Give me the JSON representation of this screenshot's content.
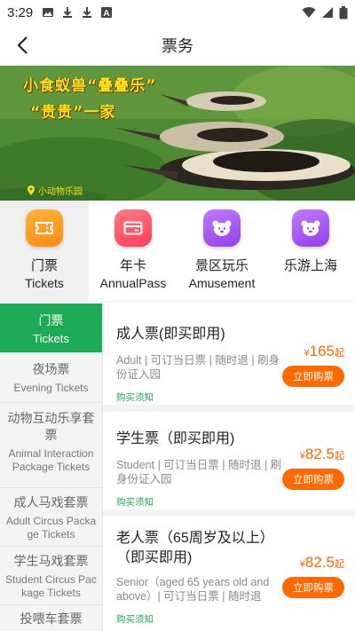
{
  "status_bar": {
    "time": "3:29",
    "left_icons": [
      "image-icon",
      "download-icon",
      "download-icon",
      "font-a-icon"
    ],
    "right_icons": [
      "wifi-icon",
      "signal-icon",
      "battery-icon"
    ]
  },
  "header": {
    "title": "票务",
    "back_icon": "back-arrow-icon"
  },
  "banner": {
    "line1": "小食蚁兽“叠叠乐”",
    "line2": "“贵贵”一家",
    "logo_text": "小动物乐园"
  },
  "categories": [
    {
      "label_cn": "门票",
      "label_en": "Tickets",
      "icon": "ticket-icon",
      "color": "#ff9a1f",
      "active": true
    },
    {
      "label_cn": "年卡",
      "label_en": "AnnualPass",
      "icon": "card-icon",
      "color": "#ff4f63",
      "active": false
    },
    {
      "label_cn": "景区玩乐",
      "label_en": "Amusement",
      "icon": "bear-face-icon",
      "color": "#a24ff0",
      "active": false
    },
    {
      "label_cn": "乐游上海",
      "label_en": "",
      "icon": "bear-face-icon",
      "color": "#a24ff0",
      "active": false
    }
  ],
  "sidebar": {
    "items": [
      {
        "cn": "门票",
        "en": "Tickets",
        "active": true
      },
      {
        "cn": "夜场票",
        "en": "Evening Tickets",
        "active": false
      },
      {
        "cn": "动物互动乐享套票",
        "en": "Animal Interaction Package Tickets",
        "active": false
      },
      {
        "cn": "成人马戏套票",
        "en": "Adult Circus Package Tickets",
        "active": false
      },
      {
        "cn": "学生马戏套票",
        "en": "Student Circus Package Tickets",
        "active": false
      },
      {
        "cn": "投喂车套票",
        "en": "",
        "active": false
      }
    ]
  },
  "tickets": [
    {
      "title": "成人票(即买即用)",
      "desc": "Adult | 可订当日票 | 随时退 | 刷身份证入园",
      "currency": "¥",
      "price": "165",
      "suffix": "起",
      "buy_label": "立即购票",
      "notice": "购买须知"
    },
    {
      "title": "学生票（即买即用)",
      "desc": "Student | 可订当日票 | 随时退 | 刷身份证入园",
      "currency": "¥",
      "price": "82.5",
      "suffix": "起",
      "buy_label": "立即购票",
      "notice": "购买须知"
    },
    {
      "title": "老人票（65周岁及以上）（即买即用)",
      "desc": "Senior（aged 65 years old and above）| 可订当日票 | 随时退",
      "currency": "¥",
      "price": "82.5",
      "suffix": "起",
      "buy_label": "立即购票",
      "notice": "购买须知"
    }
  ],
  "colors": {
    "accent_green": "#1eab57",
    "price_orange": "#ff6600",
    "button_orange": "#ff6a00"
  }
}
